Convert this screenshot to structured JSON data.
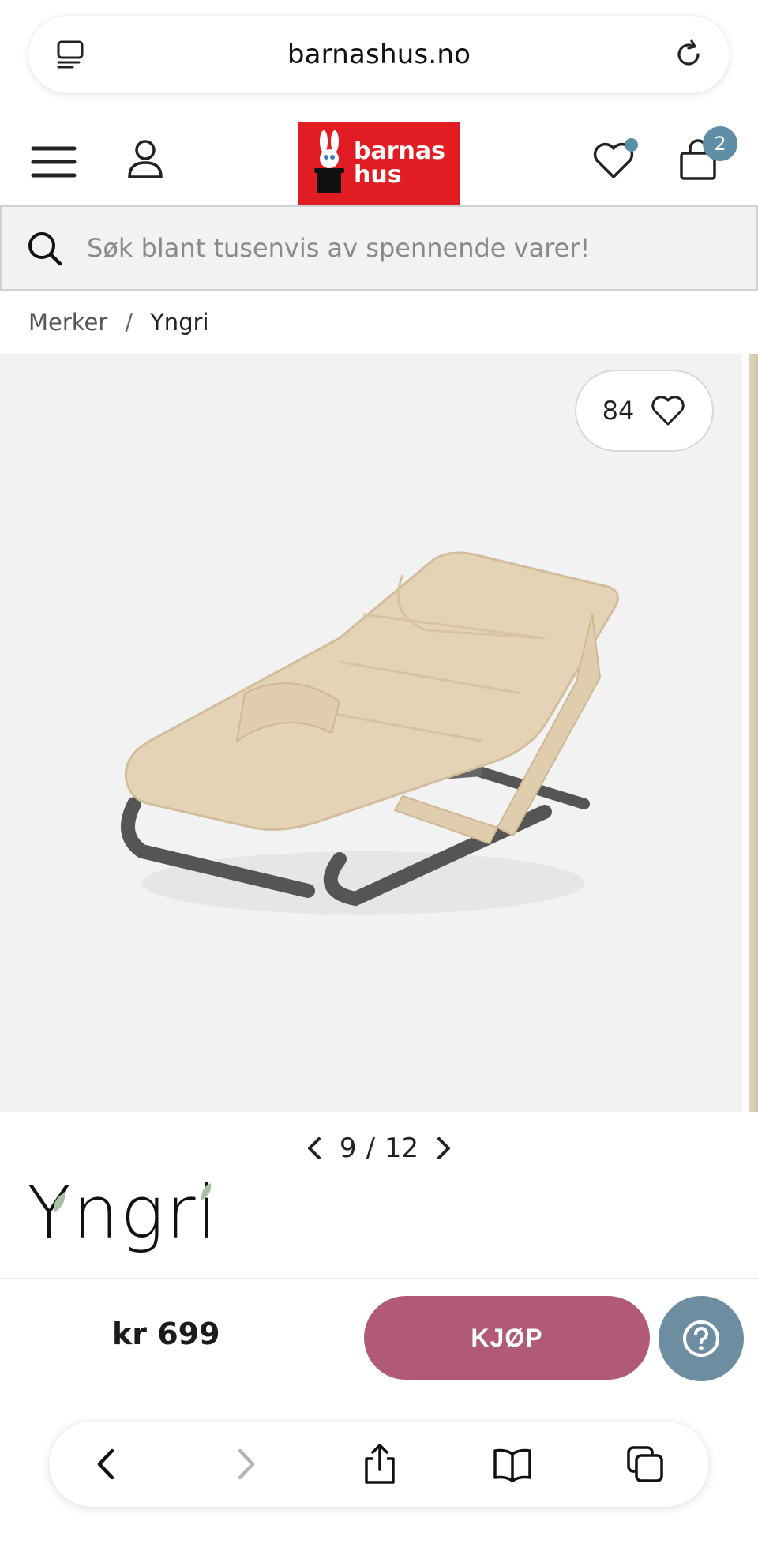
{
  "browser": {
    "url": "barnashus.no",
    "left_icon": "reader-icon",
    "right_icon": "reload-icon"
  },
  "header": {
    "logo_lines": [
      "barnas",
      "hus"
    ],
    "cart_count": "2",
    "wishlist_has_items": true,
    "accent_color": "#e21c23"
  },
  "search": {
    "placeholder": "Søk blant tusenvis av spennende varer!"
  },
  "breadcrumb": {
    "items": [
      "Merker",
      "Yngri"
    ],
    "separator": "/"
  },
  "gallery": {
    "favorite_count": "84",
    "current": "9",
    "total": "12"
  },
  "brand": {
    "name": "Yngri"
  },
  "buy": {
    "price": "kr 699",
    "button_label": "KJØP",
    "button_color": "#b15a78"
  },
  "toolbar": {
    "icons": [
      "back-icon",
      "forward-icon",
      "share-icon",
      "bookmarks-icon",
      "tabs-icon"
    ]
  }
}
